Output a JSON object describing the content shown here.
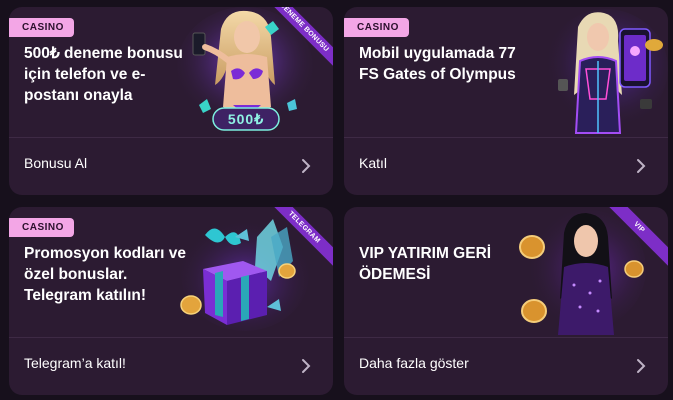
{
  "colors": {
    "page_bg": "#17101c",
    "card_bg": "#2c1b32",
    "badge_bg": "#f3a6e6",
    "ribbon_bg": "#7d2ec7",
    "accent_purple": "#9b3cf0"
  },
  "cards": [
    {
      "badge": "CASINO",
      "title": "500₺ deneme bonusu için telefon ve e-postanı onayla",
      "ribbon": "DENEME BONUSU",
      "art_text": "500₺",
      "action": "Bonusu Al",
      "icon": "chevron-right-icon"
    },
    {
      "badge": "CASINO",
      "title": "Mobil uygulamada 77 FS Gates of Olympus",
      "action": "Katıl",
      "icon": "chevron-right-icon"
    },
    {
      "badge": "CASINO",
      "title": "Promosyon kodları ve özel bonuslar. Telegram katılın!",
      "ribbon": "TELEGRAM",
      "action": "Telegram’a katıl!",
      "icon": "chevron-right-icon"
    },
    {
      "title": "VIP YATIRIM GERİ ÖDEMESİ",
      "ribbon": "VIP",
      "action": "Daha fazla göster",
      "icon": "chevron-right-icon"
    }
  ]
}
